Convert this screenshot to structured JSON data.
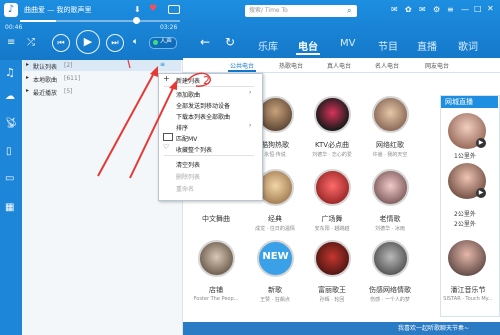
{
  "player": {
    "song_title": "曲曲爱 — 我的歌声里",
    "time_elapsed": "00:46",
    "time_total": "03:26",
    "sound_effect_label": "人声",
    "search_placeholder": "搜索/ Time To"
  },
  "nav": {
    "tabs": [
      {
        "label": "乐库"
      },
      {
        "label": "电台"
      },
      {
        "label": "MV"
      },
      {
        "label": "节目"
      },
      {
        "label": "直播"
      },
      {
        "label": "歌词"
      }
    ],
    "active": "电台"
  },
  "radio_tabs": [
    "公共电台",
    "热歌电台",
    "真人电台",
    "名人电台",
    "网友电台"
  ],
  "playlists": [
    {
      "name": "默认列表",
      "count": "[2]"
    },
    {
      "name": "本地歌曲",
      "count": "[611]"
    },
    {
      "name": "最近播放",
      "count": "[5]"
    }
  ],
  "context_menu": {
    "items": [
      {
        "label": "新建列表",
        "enabled": true,
        "submenu": false
      },
      {
        "label": "添加歌曲",
        "enabled": true,
        "submenu": true
      },
      {
        "label": "全部发送到移动设备",
        "enabled": true,
        "submenu": false
      },
      {
        "label": "下载本列表全部歌曲",
        "enabled": true,
        "submenu": false
      },
      {
        "label": "排序",
        "enabled": true,
        "submenu": true
      },
      {
        "label": "匹配MV",
        "enabled": true,
        "submenu": false
      },
      {
        "label": "收藏整个列表",
        "enabled": true,
        "submenu": false
      },
      {
        "label": "清空列表",
        "enabled": true,
        "submenu": false
      },
      {
        "label": "删除列表",
        "enabled": false,
        "submenu": false
      },
      {
        "label": "重命名",
        "enabled": false,
        "submenu": false
      }
    ]
  },
  "stations": [
    {
      "name": "酷狗热歌",
      "sub": "永恒·传说"
    },
    {
      "name": "KTV必点曲",
      "sub": "刘德华 · 忘心的爱"
    },
    {
      "name": "网络红歌",
      "sub": "许嵩 · 我的天空"
    },
    {
      "name": "中文舞曲",
      "sub": ""
    },
    {
      "name": "经典",
      "sub": "成龙 · 往日的温情"
    },
    {
      "name": "广场舞",
      "sub": "安东阳 · 越跳越"
    },
    {
      "name": "老情歌",
      "sub": "刘德华 · 冰雨"
    },
    {
      "name": "店铺",
      "sub": "Foster The Peop..."
    },
    {
      "name": "新歌",
      "sub": "王赞 · 狂飙点"
    },
    {
      "name": "富丽歌王",
      "sub": "孙辉 · 轮回"
    },
    {
      "name": "伤感网络情歌",
      "sub": "伤感 · 一个人的梦"
    }
  ],
  "sidebar": {
    "header": "网城直播",
    "items": [
      {
        "label": "1公里外"
      },
      {
        "label": "2公里外"
      },
      {
        "label": "2公里外"
      }
    ],
    "last_name": "潘江音乐节",
    "last_sub": "SISTAR · Touch My..."
  },
  "footer": {
    "text": "我喜欢一起听歌聊天节奏~"
  },
  "annotations": {
    "number": "2"
  },
  "colors": {
    "accent": "#1578c9",
    "annotation": "#e53935"
  }
}
